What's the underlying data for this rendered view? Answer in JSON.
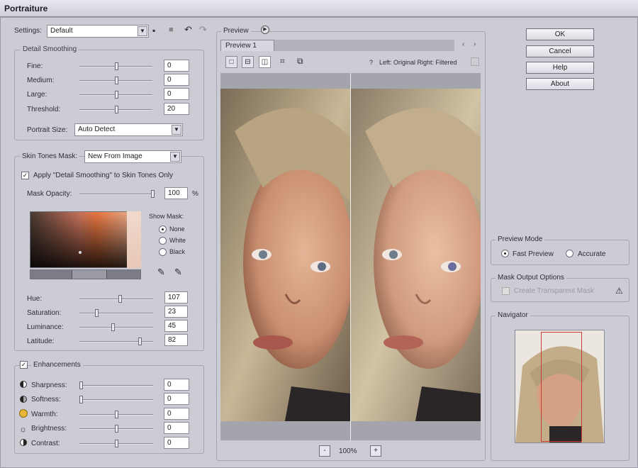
{
  "window": {
    "title": "Portraiture"
  },
  "settings": {
    "label": "Settings:",
    "value": "Default"
  },
  "detail_smoothing": {
    "title": "Detail Smoothing",
    "rows": [
      {
        "label": "Fine:",
        "value": "0"
      },
      {
        "label": "Medium:",
        "value": "0"
      },
      {
        "label": "Large:",
        "value": "0"
      },
      {
        "label": "Threshold:",
        "value": "20"
      }
    ],
    "portrait_size_label": "Portrait Size:",
    "portrait_size_value": "Auto Detect"
  },
  "skin_tones": {
    "title": "Skin Tones Mask:",
    "select_value": "New From Image",
    "apply_label": "Apply \"Detail Smoothing\" to Skin Tones Only",
    "mask_opacity_label": "Mask Opacity:",
    "mask_opacity_value": "100",
    "mask_opacity_unit": "%",
    "show_mask_label": "Show Mask:",
    "show_mask_options": [
      "None",
      "White",
      "Black"
    ],
    "rows": [
      {
        "label": "Hue:",
        "value": "107"
      },
      {
        "label": "Saturation:",
        "value": "23"
      },
      {
        "label": "Luminance:",
        "value": "45"
      },
      {
        "label": "Latitude:",
        "value": "82"
      }
    ]
  },
  "enhancements": {
    "title": "Enhancements",
    "rows": [
      {
        "label": "Sharpness:",
        "value": "0"
      },
      {
        "label": "Softness:",
        "value": "0"
      },
      {
        "label": "Warmth:",
        "value": "0"
      },
      {
        "label": "Brightness:",
        "value": "0"
      },
      {
        "label": "Contrast:",
        "value": "0"
      }
    ]
  },
  "preview": {
    "group_label": "Preview",
    "tab_label": "Preview 1",
    "toggle_hint": "?",
    "split_caption": "Left: Original Right: Filtered",
    "zoom": "100%",
    "zoom_minus": "-",
    "zoom_plus": "+"
  },
  "buttons": {
    "ok": "OK",
    "cancel": "Cancel",
    "help": "Help",
    "about": "About"
  },
  "preview_mode": {
    "title": "Preview Mode",
    "options": [
      "Fast Preview",
      "Accurate"
    ]
  },
  "mask_output": {
    "title": "Mask Output Options",
    "option": "Create Transparent Mask"
  },
  "navigator": {
    "title": "Navigator"
  }
}
